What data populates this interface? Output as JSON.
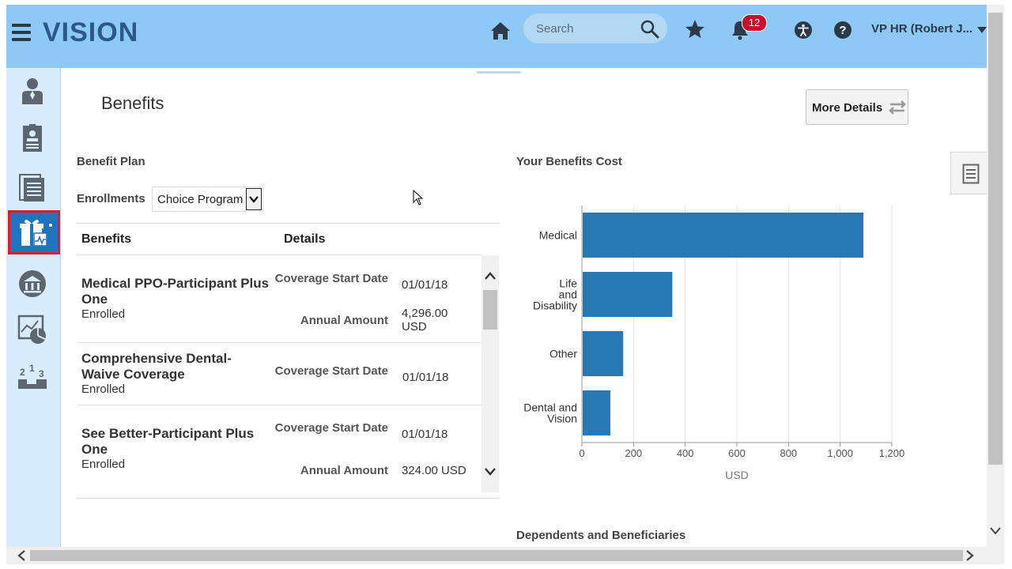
{
  "header": {
    "logo": "VISION",
    "search_placeholder": "Search",
    "notification_count": "12",
    "user_label": "VP HR (Robert J..."
  },
  "sidebar": {
    "items": [
      {
        "icon": "person-icon"
      },
      {
        "icon": "id-badge-icon"
      },
      {
        "icon": "document-list-icon"
      },
      {
        "icon": "benefits-gift-icon",
        "active": true
      },
      {
        "icon": "bank-icon"
      },
      {
        "icon": "pie-chart-icon"
      },
      {
        "icon": "ranking-podium-icon"
      }
    ]
  },
  "page": {
    "title": "Benefits",
    "more_details_label": "More Details"
  },
  "benefit_plan": {
    "section_title": "Benefit Plan",
    "enrollments_label": "Enrollments",
    "enrollments_value": "Choice Program",
    "columns": [
      "Benefits",
      "Details"
    ],
    "rows": [
      {
        "title": "Medical PPO-Participant Plus One",
        "status": "Enrolled",
        "details": [
          {
            "label": "Coverage Start Date",
            "value": "01/01/18"
          },
          {
            "label": "Annual Amount",
            "value": "4,296.00 USD"
          }
        ]
      },
      {
        "title": "Comprehensive Dental-Waive Coverage",
        "status": "Enrolled",
        "details": [
          {
            "label": "Coverage Start Date",
            "value": "01/01/18"
          }
        ]
      },
      {
        "title": "See Better-Participant Plus One",
        "status": "Enrolled",
        "details": [
          {
            "label": "Coverage Start Date",
            "value": "01/01/18"
          },
          {
            "label": "Annual Amount",
            "value": "324.00 USD"
          }
        ]
      }
    ]
  },
  "chart_data": {
    "type": "bar",
    "orientation": "horizontal",
    "title": "Your Benefits Cost",
    "categories": [
      "Medical",
      "Life and Disability",
      "Other",
      "Dental and Vision"
    ],
    "values": [
      1090,
      350,
      160,
      110
    ],
    "xlabel": "USD",
    "xlim": [
      0,
      1200
    ],
    "xticks": [
      "0",
      "200",
      "400",
      "600",
      "800",
      "1,000",
      "1,200"
    ],
    "grid": true,
    "bar_color": "#2878b5"
  },
  "dependents": {
    "section_title": "Dependents and Beneficiaries"
  },
  "colors": {
    "header_bg": "#8ec8f5",
    "sidebar_bg": "#d9ecfb",
    "active_item_bg": "#1f74c0",
    "highlight_border": "#e31b23",
    "badge_bg": "#c8102e"
  }
}
